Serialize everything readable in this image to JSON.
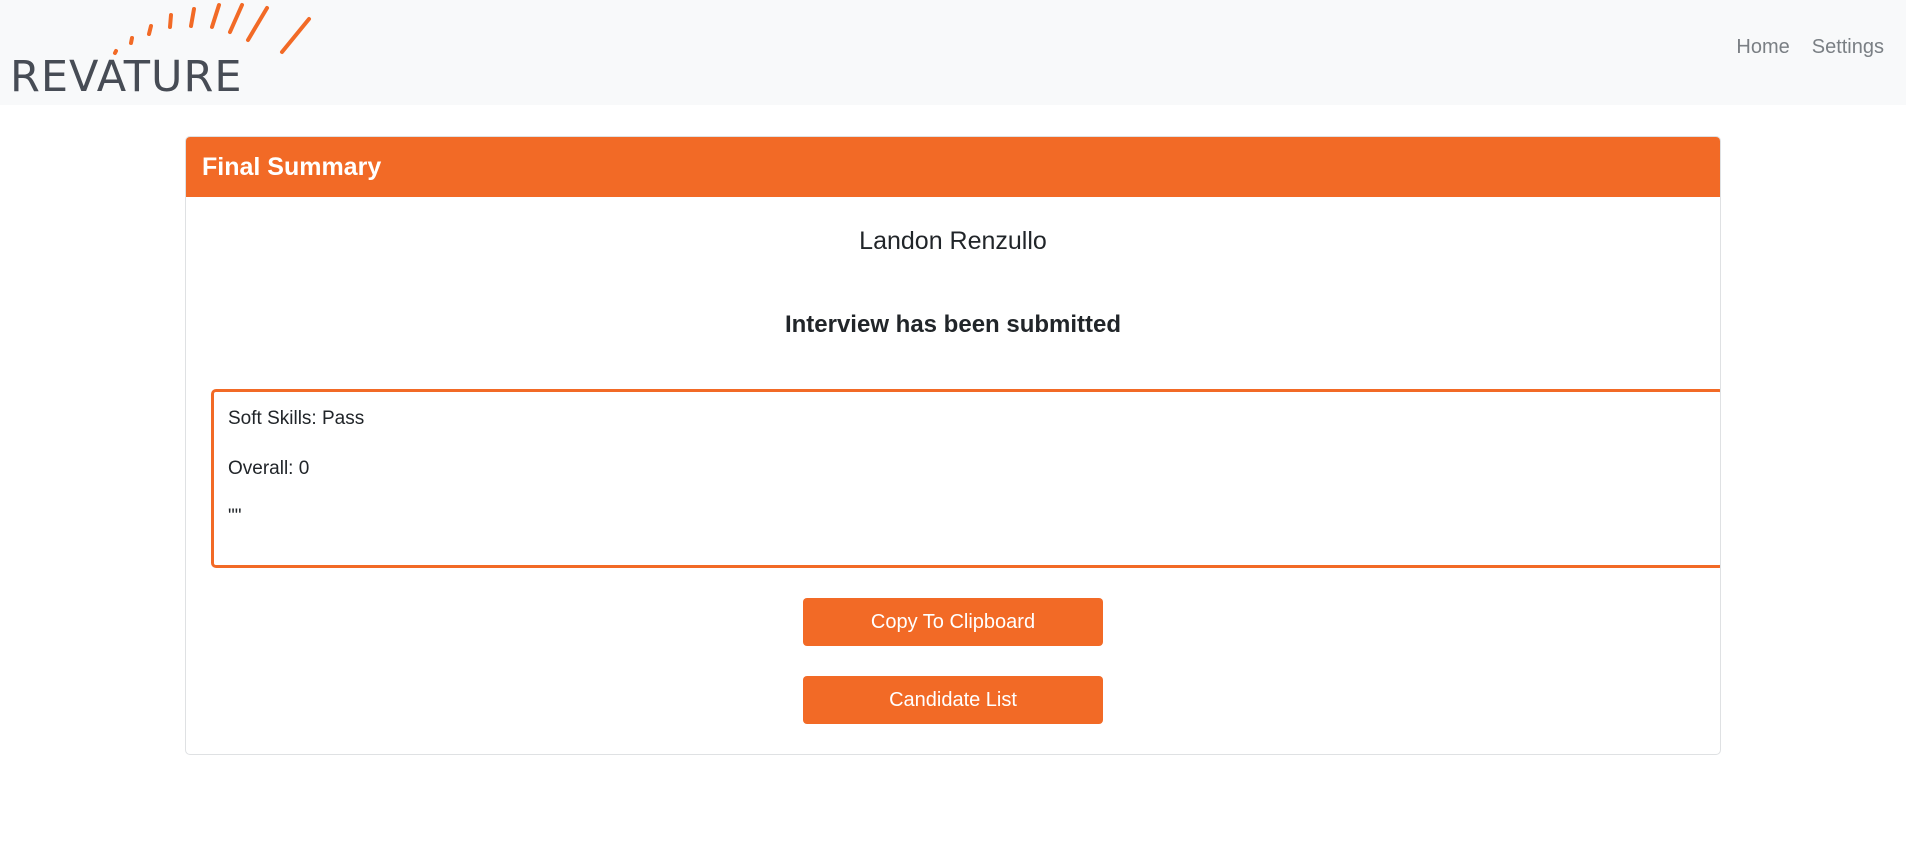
{
  "navbar": {
    "logo_text": "REVATURE",
    "links": [
      "Home",
      "Settings"
    ]
  },
  "card": {
    "header": "Final Summary",
    "candidate_name": "Landon Renzullo",
    "status": "Interview has been submitted",
    "summary_lines": [
      "Soft Skills: Pass",
      "Overall: 0",
      "\"\""
    ],
    "buttons": {
      "copy": "Copy To Clipboard",
      "candidates": "Candidate List"
    }
  },
  "colors": {
    "accent": "#f26a26",
    "navbar_bg": "#f8f9fa",
    "logo_text": "#474c55"
  }
}
